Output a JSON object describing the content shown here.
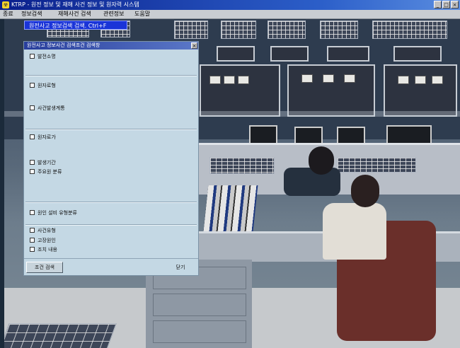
{
  "window": {
    "icon_glyph": "☢",
    "title": "KTRP - 원전 정보 및 재해 사건 정보 및 원자력 시스템",
    "controls": [
      "_",
      "□",
      "×"
    ]
  },
  "menu": {
    "items": [
      "종료",
      "정보검색",
      "재해사건 검색",
      "관련정보",
      "도움말"
    ]
  },
  "banner": {
    "text": "원전사고 정보검색 검색.   Ctrl+F"
  },
  "dialog": {
    "title": "원전사고 정보사건 검색조건 검색창",
    "close_glyph": "×",
    "options": [
      {
        "label": "발전소명"
      },
      {
        "label": "원자로형"
      },
      {
        "label": "사건발생계통"
      },
      {
        "label": "원자로가"
      },
      {
        "label": "발생기간"
      },
      {
        "label": "주요원 분류"
      },
      {
        "label": "원인 설비 유형분류"
      },
      {
        "label": "사건유형"
      },
      {
        "label": "고장원인"
      },
      {
        "label": "조치 내용"
      }
    ],
    "search_button": "조건 검색",
    "close_button": "닫기"
  }
}
